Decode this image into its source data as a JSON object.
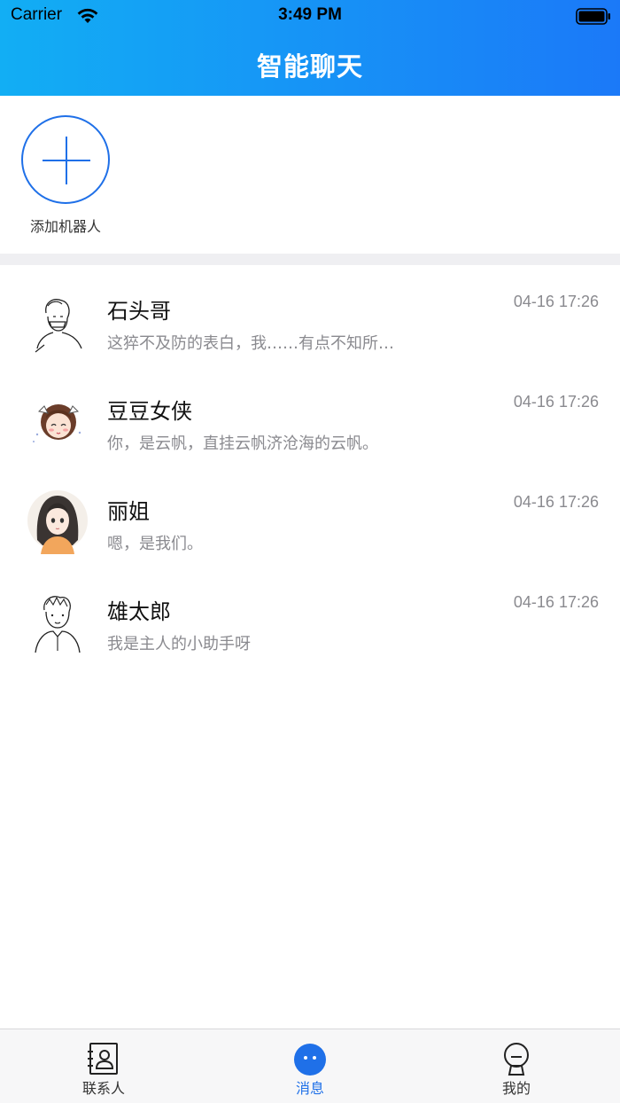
{
  "status_bar": {
    "carrier": "Carrier",
    "time": "3:49 PM"
  },
  "nav": {
    "title": "智能聊天"
  },
  "robot_section": {
    "add_label": "添加机器人"
  },
  "chats": [
    {
      "name": "石头哥",
      "preview": "这猝不及防的表白，我……有点不知所…",
      "time": "04-16 17:26",
      "avatar": "sketch-boy-avatar"
    },
    {
      "name": "豆豆女侠",
      "preview": "你，是云帆，直挂云帆济沧海的云帆。",
      "time": "04-16 17:26",
      "avatar": "cartoon-girl-avatar"
    },
    {
      "name": "丽姐",
      "preview": "嗯，是我们。",
      "time": "04-16 17:26",
      "avatar": "illustrated-woman-avatar"
    },
    {
      "name": "雄太郎",
      "preview": "我是主人的小助手呀",
      "time": "04-16 17:26",
      "avatar": "sketch-man-avatar"
    }
  ],
  "tabbar": {
    "contacts": "联系人",
    "messages": "消息",
    "mine": "我的",
    "active": "messages",
    "active_color": "#1f70e8"
  },
  "colors": {
    "header_start": "#12aef4",
    "header_end": "#1b79f8",
    "accent": "#1f70e8"
  }
}
